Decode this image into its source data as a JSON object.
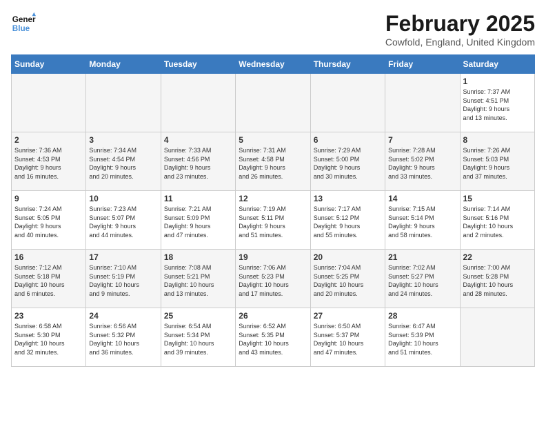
{
  "logo": {
    "line1": "General",
    "line2": "Blue"
  },
  "title": "February 2025",
  "location": "Cowfold, England, United Kingdom",
  "days_of_week": [
    "Sunday",
    "Monday",
    "Tuesday",
    "Wednesday",
    "Thursday",
    "Friday",
    "Saturday"
  ],
  "weeks": [
    [
      {
        "num": "",
        "info": ""
      },
      {
        "num": "",
        "info": ""
      },
      {
        "num": "",
        "info": ""
      },
      {
        "num": "",
        "info": ""
      },
      {
        "num": "",
        "info": ""
      },
      {
        "num": "",
        "info": ""
      },
      {
        "num": "1",
        "info": "Sunrise: 7:37 AM\nSunset: 4:51 PM\nDaylight: 9 hours\nand 13 minutes."
      }
    ],
    [
      {
        "num": "2",
        "info": "Sunrise: 7:36 AM\nSunset: 4:53 PM\nDaylight: 9 hours\nand 16 minutes."
      },
      {
        "num": "3",
        "info": "Sunrise: 7:34 AM\nSunset: 4:54 PM\nDaylight: 9 hours\nand 20 minutes."
      },
      {
        "num": "4",
        "info": "Sunrise: 7:33 AM\nSunset: 4:56 PM\nDaylight: 9 hours\nand 23 minutes."
      },
      {
        "num": "5",
        "info": "Sunrise: 7:31 AM\nSunset: 4:58 PM\nDaylight: 9 hours\nand 26 minutes."
      },
      {
        "num": "6",
        "info": "Sunrise: 7:29 AM\nSunset: 5:00 PM\nDaylight: 9 hours\nand 30 minutes."
      },
      {
        "num": "7",
        "info": "Sunrise: 7:28 AM\nSunset: 5:02 PM\nDaylight: 9 hours\nand 33 minutes."
      },
      {
        "num": "8",
        "info": "Sunrise: 7:26 AM\nSunset: 5:03 PM\nDaylight: 9 hours\nand 37 minutes."
      }
    ],
    [
      {
        "num": "9",
        "info": "Sunrise: 7:24 AM\nSunset: 5:05 PM\nDaylight: 9 hours\nand 40 minutes."
      },
      {
        "num": "10",
        "info": "Sunrise: 7:23 AM\nSunset: 5:07 PM\nDaylight: 9 hours\nand 44 minutes."
      },
      {
        "num": "11",
        "info": "Sunrise: 7:21 AM\nSunset: 5:09 PM\nDaylight: 9 hours\nand 47 minutes."
      },
      {
        "num": "12",
        "info": "Sunrise: 7:19 AM\nSunset: 5:11 PM\nDaylight: 9 hours\nand 51 minutes."
      },
      {
        "num": "13",
        "info": "Sunrise: 7:17 AM\nSunset: 5:12 PM\nDaylight: 9 hours\nand 55 minutes."
      },
      {
        "num": "14",
        "info": "Sunrise: 7:15 AM\nSunset: 5:14 PM\nDaylight: 9 hours\nand 58 minutes."
      },
      {
        "num": "15",
        "info": "Sunrise: 7:14 AM\nSunset: 5:16 PM\nDaylight: 10 hours\nand 2 minutes."
      }
    ],
    [
      {
        "num": "16",
        "info": "Sunrise: 7:12 AM\nSunset: 5:18 PM\nDaylight: 10 hours\nand 6 minutes."
      },
      {
        "num": "17",
        "info": "Sunrise: 7:10 AM\nSunset: 5:19 PM\nDaylight: 10 hours\nand 9 minutes."
      },
      {
        "num": "18",
        "info": "Sunrise: 7:08 AM\nSunset: 5:21 PM\nDaylight: 10 hours\nand 13 minutes."
      },
      {
        "num": "19",
        "info": "Sunrise: 7:06 AM\nSunset: 5:23 PM\nDaylight: 10 hours\nand 17 minutes."
      },
      {
        "num": "20",
        "info": "Sunrise: 7:04 AM\nSunset: 5:25 PM\nDaylight: 10 hours\nand 20 minutes."
      },
      {
        "num": "21",
        "info": "Sunrise: 7:02 AM\nSunset: 5:27 PM\nDaylight: 10 hours\nand 24 minutes."
      },
      {
        "num": "22",
        "info": "Sunrise: 7:00 AM\nSunset: 5:28 PM\nDaylight: 10 hours\nand 28 minutes."
      }
    ],
    [
      {
        "num": "23",
        "info": "Sunrise: 6:58 AM\nSunset: 5:30 PM\nDaylight: 10 hours\nand 32 minutes."
      },
      {
        "num": "24",
        "info": "Sunrise: 6:56 AM\nSunset: 5:32 PM\nDaylight: 10 hours\nand 36 minutes."
      },
      {
        "num": "25",
        "info": "Sunrise: 6:54 AM\nSunset: 5:34 PM\nDaylight: 10 hours\nand 39 minutes."
      },
      {
        "num": "26",
        "info": "Sunrise: 6:52 AM\nSunset: 5:35 PM\nDaylight: 10 hours\nand 43 minutes."
      },
      {
        "num": "27",
        "info": "Sunrise: 6:50 AM\nSunset: 5:37 PM\nDaylight: 10 hours\nand 47 minutes."
      },
      {
        "num": "28",
        "info": "Sunrise: 6:47 AM\nSunset: 5:39 PM\nDaylight: 10 hours\nand 51 minutes."
      },
      {
        "num": "",
        "info": ""
      }
    ]
  ]
}
